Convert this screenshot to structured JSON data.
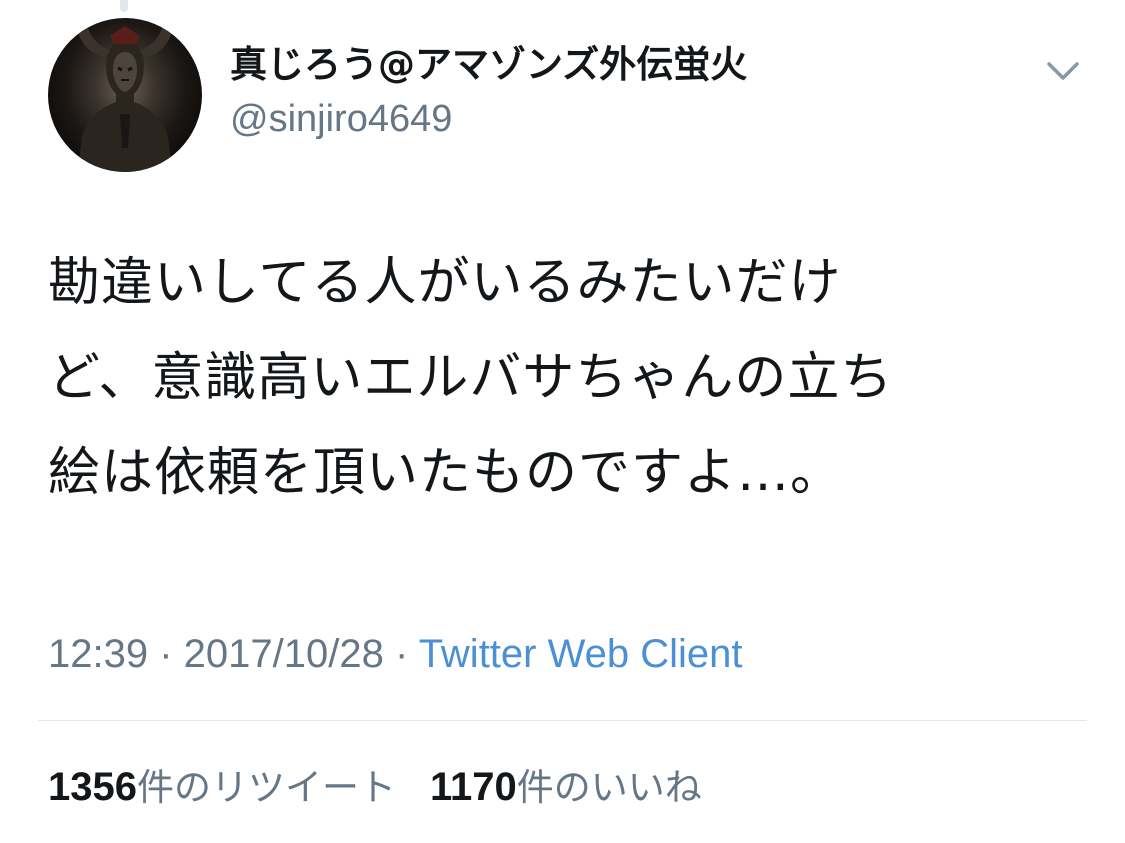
{
  "user": {
    "display_name": "真じろう@アマゾンズ外伝蛍火",
    "handle": "@sinjiro4649",
    "avatar_icon": "user-avatar"
  },
  "menu": {
    "icon": "chevron-down-icon"
  },
  "tweet": {
    "text_lines": [
      "勘違いしてる人がいるみたいだけ",
      "ど、意識高いエルバサちゃんの立ち",
      "絵は依頼を頂いたものですよ…。"
    ]
  },
  "meta": {
    "time": "12:39",
    "separator": " · ",
    "date": "2017/10/28",
    "source": "Twitter Web Client"
  },
  "stats": {
    "retweets_count": "1356",
    "retweets_label": "件のリツイート",
    "likes_count": "1170",
    "likes_label": "件のいいね"
  },
  "colors": {
    "text": "#14171a",
    "secondary": "#657786",
    "link": "#4b8fd4",
    "divider": "#e1e8ed"
  }
}
